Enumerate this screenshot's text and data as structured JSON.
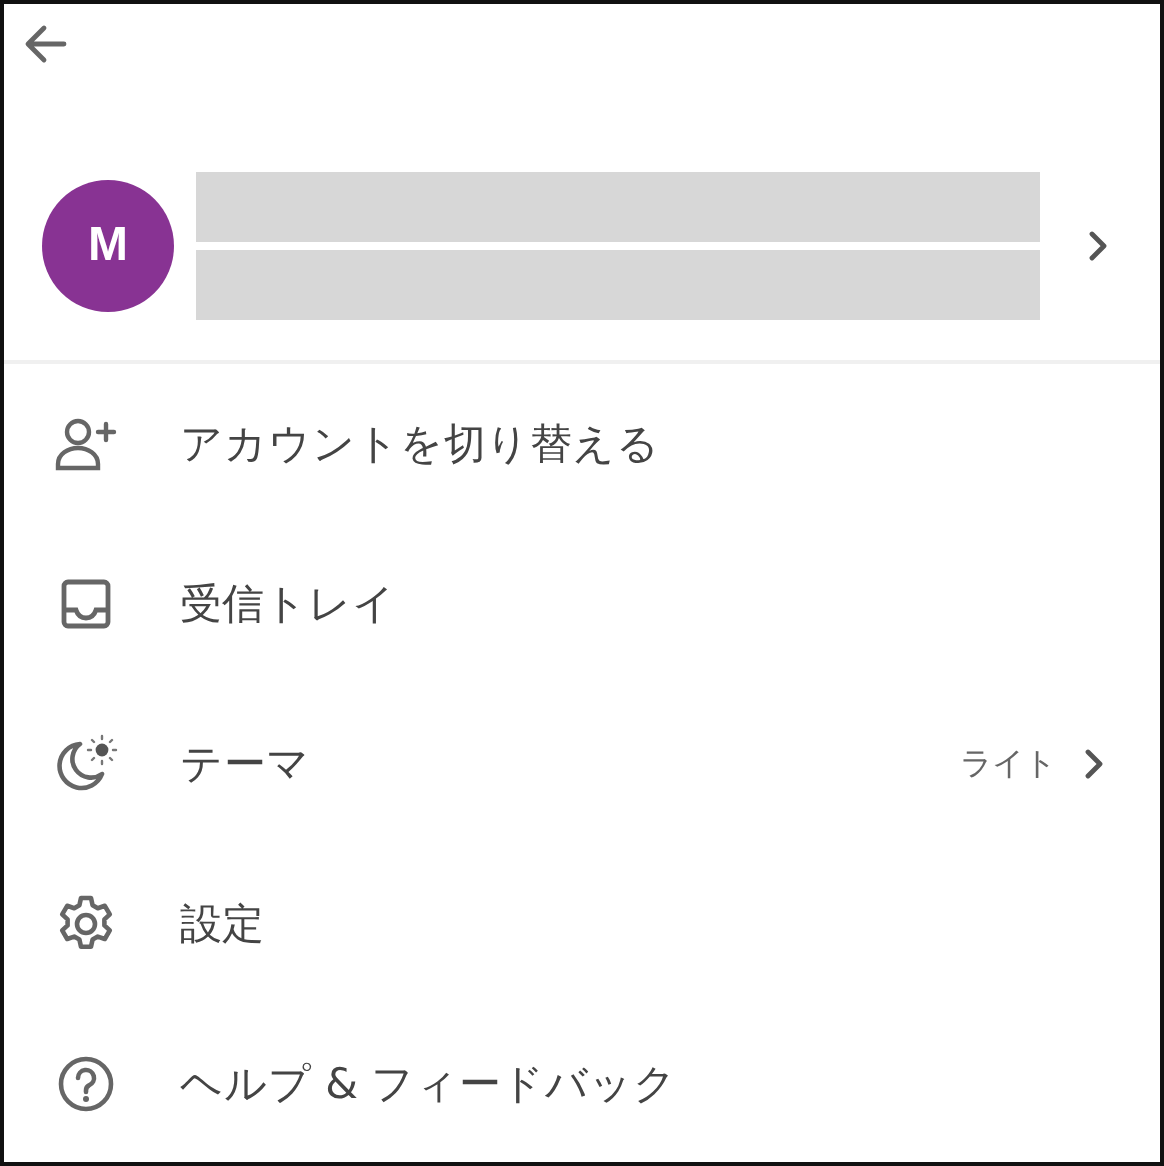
{
  "account": {
    "initial": "M"
  },
  "menu": [
    {
      "kind": "person-add",
      "label": "アカウントを切り替える"
    },
    {
      "kind": "inbox",
      "label": "受信トレイ"
    },
    {
      "kind": "theme",
      "label": "テーマ",
      "value": "ライト"
    },
    {
      "kind": "settings",
      "label": "設定"
    },
    {
      "kind": "help",
      "label": "ヘルプ & フィードバック"
    }
  ]
}
